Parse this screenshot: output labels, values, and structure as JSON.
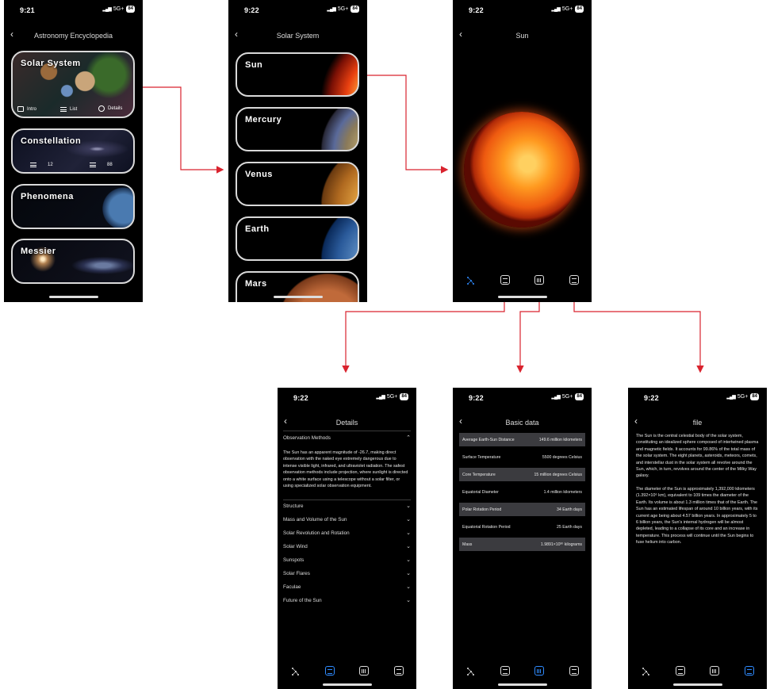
{
  "status": {
    "network": "5G+",
    "battery": "84"
  },
  "screen1": {
    "time": "9:21",
    "title": "Astronomy Encyclopedia",
    "cards": [
      {
        "label": "Solar System",
        "meta": [
          "Intro",
          "List",
          "Details"
        ]
      },
      {
        "label": "Constellation",
        "meta": [
          "12",
          "88"
        ]
      },
      {
        "label": "Phenomena"
      },
      {
        "label": "Messier"
      }
    ]
  },
  "screen2": {
    "time": "9:22",
    "title": "Solar System",
    "planets": [
      "Sun",
      "Mercury",
      "Venus",
      "Earth",
      "Mars"
    ]
  },
  "screen3": {
    "time": "9:22",
    "title": "Sun"
  },
  "screen4": {
    "time": "9:22",
    "title": "Details",
    "open_section": "Observation Methods",
    "paragraph": "The Sun has an apparent magnitude of -26.7, making direct observation with the naked eye extremely dangerous due to intense visible light, infrared, and ultraviolet radiation. The safest observation methods include projection, where sunlight is directed onto a white surface using a telescope without a solar filter, or using specialized solar observation equipment.",
    "sections": [
      "Structure",
      "Mass and Volume of the Sun",
      "Solar Revolution and Rotation",
      "Solar Wind",
      "Sunspots",
      "Solar Flares",
      "Faculae",
      "Future of the Sun"
    ]
  },
  "screen5": {
    "time": "9:22",
    "title": "Basic data",
    "rows": [
      {
        "label": "Average Earth-Sun Distance",
        "value": "149.6 million kilometers"
      },
      {
        "label": "Surface Temperature",
        "value": "5500 degrees Celsius"
      },
      {
        "label": "Core Temperature",
        "value": "15 million degrees Celsius"
      },
      {
        "label": "Equatorial Diameter",
        "value": "1.4 million kilometers"
      },
      {
        "label": "Polar Rotation Period",
        "value": "34 Earth days"
      },
      {
        "label": "Equatorial Rotation Period",
        "value": "25 Earth days"
      },
      {
        "label": "Mass",
        "value": "1.9891×10³⁰ kilograms"
      }
    ]
  },
  "screen6": {
    "time": "9:22",
    "title": "file",
    "paragraph1": "The Sun is the central celestial body of the solar system, constituting an idealized sphere composed of intertwined plasma and magnetic fields. It accounts for 99.86% of the total mass of the solar system. The eight planets, asteroids, meteors, comets, and interstellar dust in the solar system all revolve around the Sun, which, in turn, revolves around the center of the Milky Way galaxy.",
    "paragraph2": "The diameter of the Sun is approximately 1,392,000 kilometers (1.392×10⁶ km), equivalent to 109 times the diameter of the Earth. Its volume is about 1.3 million times that of the Earth. The Sun has an estimated lifespan of around 10 billion years, with its current age being about 4.57 billion years. In approximately 5 to 6 billion years, the Sun's internal hydrogen will be almost depleted, leading to a collapse of its core and an increase in temperature. This process will continue until the Sun begins to fuse helium into carbon."
  },
  "colors": {
    "accent": "#2f8bff",
    "arrow": "#d9232e",
    "row_shade": "#3b3b3f"
  }
}
